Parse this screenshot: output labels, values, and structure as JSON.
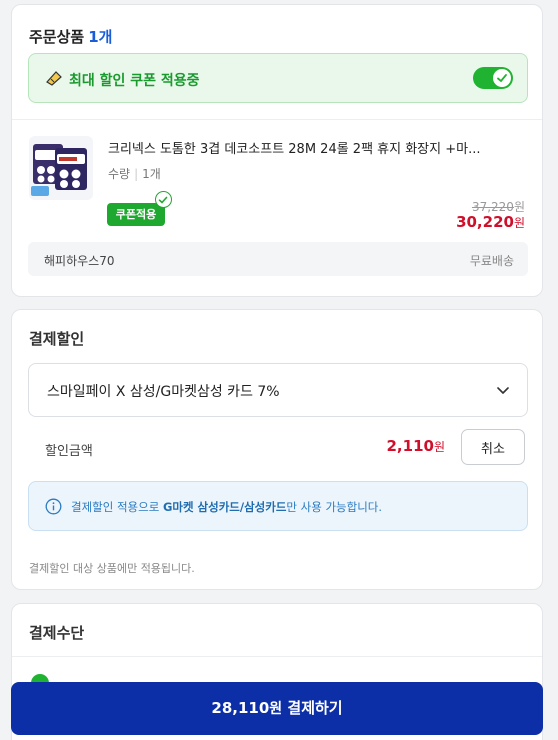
{
  "order": {
    "title": "주문상품",
    "count": "1개",
    "coupon_banner": "최대 할인 쿠폰 적용중",
    "coupon_toggle_on": true,
    "product": {
      "name": "크리넥스 도톰한 3겹 데코소프트 28M 24롤 2팩 휴지 화장지 +마...",
      "qty_label": "수량",
      "qty_value": "1개",
      "coupon_badge": "쿠폰적용",
      "original_price": "37,220",
      "original_unit": "원",
      "sale_price": "30,220",
      "sale_unit": "원"
    },
    "seller": "해피하우스70",
    "shipping": "무료배송"
  },
  "discount": {
    "title": "결제할인",
    "selected_card": "스마일페이 X 삼성/G마켓삼성 카드 7%",
    "amount_label": "할인금액",
    "amount": "2,110",
    "amount_unit": "원",
    "cancel_label": "취소",
    "info_prefix": "결제할인 적용으로 ",
    "info_bold": "G마켓 삼성카드/삼성카드",
    "info_suffix": "만 사용 가능합니다.",
    "note": "결제할인 대상 상품에만 적용됩니다."
  },
  "method": {
    "title": "결제수단"
  },
  "pay_button": {
    "amount": "28,110",
    "unit": "원",
    "label": "결제하기"
  },
  "colors": {
    "accent_green": "#1fb331",
    "price_red": "#d0102b",
    "pay_blue": "#0c2fa8",
    "count_blue": "#1a5dd8"
  }
}
